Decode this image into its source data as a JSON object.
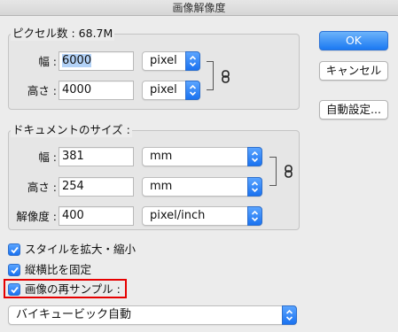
{
  "window": {
    "title": "画像解像度"
  },
  "pixel_dimensions": {
    "label": "ピクセル数 : 68.7M",
    "width_label": "幅 :",
    "width_value": "6000",
    "width_unit": "pixel",
    "height_label": "高さ :",
    "height_value": "4000",
    "height_unit": "pixel"
  },
  "document_size": {
    "label": "ドキュメントのサイズ :",
    "width_label": "幅 :",
    "width_value": "381",
    "width_unit": "mm",
    "height_label": "高さ :",
    "height_value": "254",
    "height_unit": "mm",
    "resolution_label": "解像度 :",
    "resolution_value": "400",
    "resolution_unit": "pixel/inch"
  },
  "options": {
    "scale_styles": {
      "label": "スタイルを拡大・縮小",
      "checked": true
    },
    "constrain_proportions": {
      "label": "縦横比を固定",
      "checked": true
    },
    "resample_image": {
      "label": "画像の再サンプル :",
      "checked": true
    },
    "resample_method": "バイキュービック自動"
  },
  "buttons": {
    "ok": "OK",
    "cancel": "キャンセル",
    "auto": "自動設定..."
  },
  "colors": {
    "accent": "#1a72f0",
    "highlight": "#e60000"
  }
}
